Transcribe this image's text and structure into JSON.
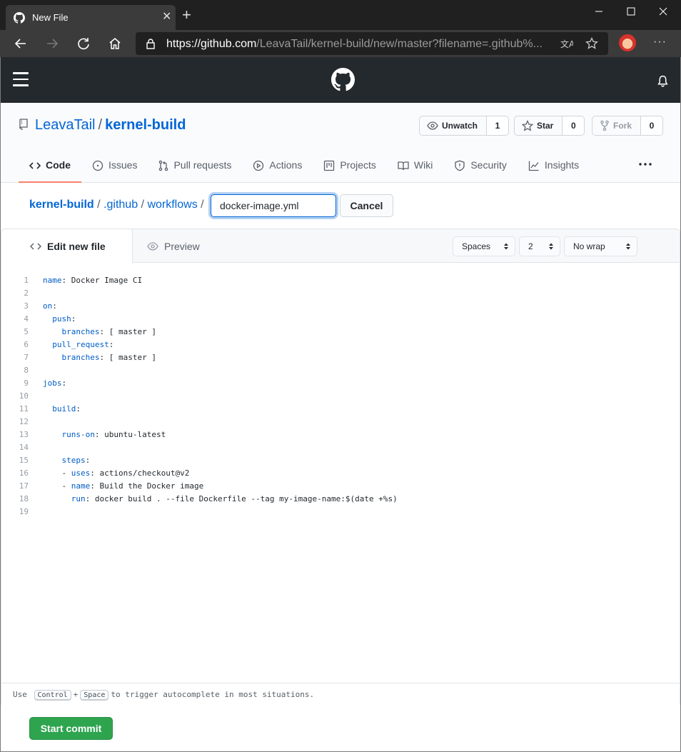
{
  "browser": {
    "tab_title": "New File",
    "url_prefix": "https://",
    "url_host": "github.com",
    "url_path": "/LeavaTail/kernel-build/new/master?filename=.github%..."
  },
  "repo": {
    "owner": "LeavaTail",
    "separator": "/",
    "name": "kernel-build",
    "watch_label": "Unwatch",
    "watch_count": "1",
    "star_label": "Star",
    "star_count": "0",
    "fork_label": "Fork",
    "fork_count": "0"
  },
  "tabs": [
    {
      "label": "Code",
      "icon": "code-icon"
    },
    {
      "label": "Issues",
      "icon": "issue-icon"
    },
    {
      "label": "Pull requests",
      "icon": "pull-request-icon"
    },
    {
      "label": "Actions",
      "icon": "play-icon"
    },
    {
      "label": "Projects",
      "icon": "project-icon"
    },
    {
      "label": "Wiki",
      "icon": "book-icon"
    },
    {
      "label": "Security",
      "icon": "shield-icon"
    },
    {
      "label": "Insights",
      "icon": "graph-icon"
    }
  ],
  "breadcrumb": {
    "root": "kernel-build",
    "dir1": ".github",
    "dir2": "workflows",
    "sep": "/"
  },
  "filename": {
    "value": "docker-image.yml"
  },
  "cancel_label": "Cancel",
  "editor": {
    "edit_tab": "Edit new file",
    "preview_tab": "Preview",
    "indent_mode": "Spaces",
    "indent_size": "2",
    "wrap_mode": "No wrap",
    "lines": [
      {
        "n": "1",
        "key": "name",
        "rest": ": Docker Image CI",
        "indent": ""
      },
      {
        "n": "2",
        "key": "",
        "rest": "",
        "indent": ""
      },
      {
        "n": "3",
        "key": "on",
        "rest": ":",
        "indent": ""
      },
      {
        "n": "4",
        "key": "push",
        "rest": ":",
        "indent": "  "
      },
      {
        "n": "5",
        "key": "branches",
        "rest": ": [ master ]",
        "indent": "    "
      },
      {
        "n": "6",
        "key": "pull_request",
        "rest": ":",
        "indent": "  "
      },
      {
        "n": "7",
        "key": "branches",
        "rest": ": [ master ]",
        "indent": "    "
      },
      {
        "n": "8",
        "key": "",
        "rest": "",
        "indent": ""
      },
      {
        "n": "9",
        "key": "jobs",
        "rest": ":",
        "indent": ""
      },
      {
        "n": "10",
        "key": "",
        "rest": "",
        "indent": ""
      },
      {
        "n": "11",
        "key": "build",
        "rest": ":",
        "indent": "  "
      },
      {
        "n": "12",
        "key": "",
        "rest": "",
        "indent": ""
      },
      {
        "n": "13",
        "key": "runs-on",
        "rest": ": ubuntu-latest",
        "indent": "    "
      },
      {
        "n": "14",
        "key": "",
        "rest": "",
        "indent": ""
      },
      {
        "n": "15",
        "key": "steps",
        "rest": ":",
        "indent": "    "
      },
      {
        "n": "16",
        "key": "uses",
        "rest": ": actions/checkout@v2",
        "indent": "    - "
      },
      {
        "n": "17",
        "key": "name",
        "rest": ": Build the Docker image",
        "indent": "    - "
      },
      {
        "n": "18",
        "key": "run",
        "rest": ": docker build . --file Dockerfile --tag my-image-name:$(date +%s)",
        "indent": "      "
      },
      {
        "n": "19",
        "key": "",
        "rest": "",
        "indent": ""
      }
    ],
    "hint_prefix": "Use",
    "hint_key1": "Control",
    "hint_plus": "+",
    "hint_key2": "Space",
    "hint_suffix": "to trigger autocomplete in most situations."
  },
  "commit_label": "Start commit",
  "colors": {
    "link": "#0366d6",
    "commit_green": "#2ea44f",
    "tab_underline": "#f9826c",
    "header_dark": "#24292e"
  }
}
